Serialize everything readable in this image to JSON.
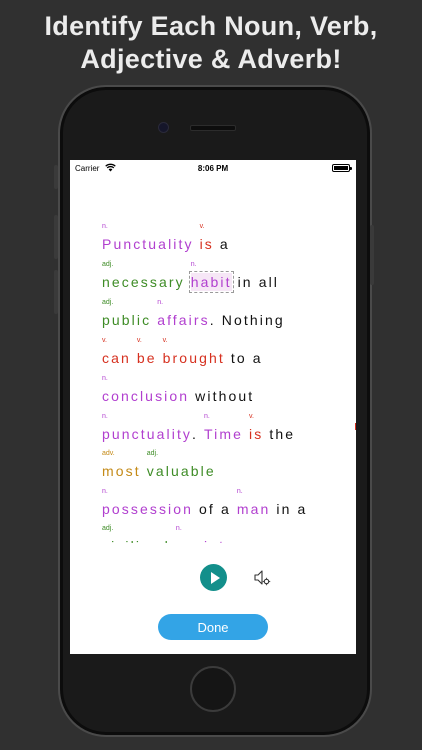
{
  "headline": {
    "line1": "Identify Each Noun, Verb,",
    "line2": "Adjective & Adverb!"
  },
  "status_bar": {
    "carrier": "Carrier",
    "time": "8:06 PM"
  },
  "lines": [
    [
      {
        "text": "Punctuality",
        "tag": "n.",
        "cls": "c-n"
      },
      {
        "text": "is",
        "tag": "v.",
        "cls": "c-v"
      },
      {
        "text": "a",
        "tag": "",
        "cls": "c-none"
      }
    ],
    [
      {
        "text": "necessary",
        "tag": "adj.",
        "cls": "c-adj"
      },
      {
        "text": "habit",
        "tag": "n.",
        "cls": "c-n",
        "selected": true
      },
      {
        "text": "in",
        "tag": "",
        "cls": "c-none"
      },
      {
        "text": "all",
        "tag": "",
        "cls": "c-none"
      }
    ],
    [
      {
        "text": "public",
        "tag": "adj.",
        "cls": "c-adj"
      },
      {
        "text": "affairs",
        "tag": "n.",
        "cls": "c-n"
      },
      {
        "text": ".",
        "tag": "",
        "cls": "c-none",
        "tight": true
      },
      {
        "text": "Nothing",
        "tag": "",
        "cls": "c-none"
      }
    ],
    [
      {
        "text": "can",
        "tag": "v.",
        "cls": "c-v"
      },
      {
        "text": "be",
        "tag": "v.",
        "cls": "c-v"
      },
      {
        "text": "brought",
        "tag": "v.",
        "cls": "c-v"
      },
      {
        "text": "to",
        "tag": "",
        "cls": "c-none"
      },
      {
        "text": "a",
        "tag": "",
        "cls": "c-none"
      }
    ],
    [
      {
        "text": "conclusion",
        "tag": "n.",
        "cls": "c-n"
      },
      {
        "text": "without",
        "tag": "",
        "cls": "c-none"
      }
    ],
    [
      {
        "text": "punctuality",
        "tag": "n.",
        "cls": "c-n"
      },
      {
        "text": ".",
        "tag": "",
        "cls": "c-none",
        "tight": true
      },
      {
        "text": "Time",
        "tag": "n.",
        "cls": "c-n"
      },
      {
        "text": "is",
        "tag": "v.",
        "cls": "c-v"
      },
      {
        "text": "the",
        "tag": "",
        "cls": "c-none"
      }
    ],
    [
      {
        "text": "most",
        "tag": "adv.",
        "cls": "c-adv"
      },
      {
        "text": "valuable",
        "tag": "adj.",
        "cls": "c-adj"
      }
    ],
    [
      {
        "text": "possession",
        "tag": "n.",
        "cls": "c-n"
      },
      {
        "text": "of",
        "tag": "",
        "cls": "c-none"
      },
      {
        "text": "a",
        "tag": "",
        "cls": "c-none"
      },
      {
        "text": "man",
        "tag": "n.",
        "cls": "c-n"
      },
      {
        "text": "in",
        "tag": "",
        "cls": "c-none"
      },
      {
        "text": "a",
        "tag": "",
        "cls": "c-none"
      }
    ],
    [
      {
        "text": "civilized",
        "tag": "adj.",
        "cls": "c-adj"
      },
      {
        "text": "society",
        "tag": "n.",
        "cls": "c-n"
      }
    ]
  ],
  "controls": {
    "play_icon": "play-icon",
    "sound_settings_icon": "speaker-gear-icon",
    "done_label": "Done"
  },
  "colors": {
    "noun": "#b13fcf",
    "verb": "#d6301f",
    "adjective": "#3e8c26",
    "adverb": "#c48a17",
    "play": "#138f8b",
    "done": "#33a4e6"
  }
}
